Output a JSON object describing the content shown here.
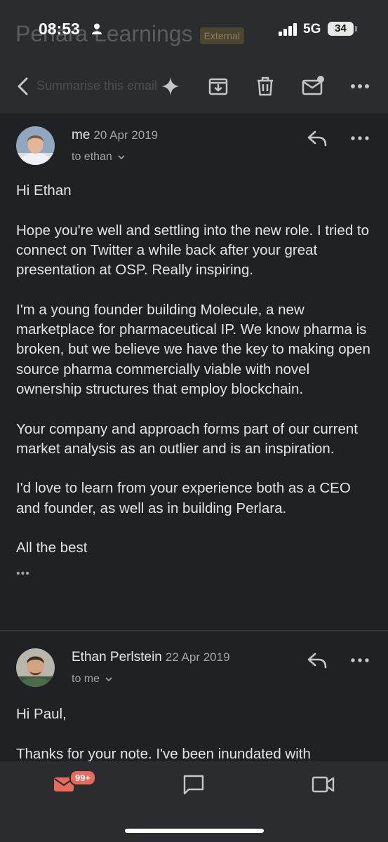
{
  "status_bar": {
    "time": "08:53",
    "network": "5G",
    "battery": "34"
  },
  "header": {
    "ghost_subject": "Perlara Learnings",
    "ghost_badge": "External",
    "ghost_summary": "Summarise this email"
  },
  "toolbar": {
    "icons": [
      "back-arrow-icon",
      "sparkle-icon",
      "archive-icon",
      "trash-icon",
      "mark-unread-icon",
      "more-icon"
    ]
  },
  "messages": [
    {
      "sender": "me",
      "date": "20 Apr 2019",
      "recipient": "to ethan",
      "paragraphs": [
        "Hi Ethan",
        "Hope you're well and settling into the new role. I tried to connect on Twitter a while back after your great presentation at OSP. Really inspiring.",
        "I'm a young founder building Molecule, a new marketplace for pharmaceutical IP. We know pharma is broken, but we believe we have the key to making open source pharma commercially viable with novel ownership structures that employ blockchain.",
        "Your company and approach forms part of our current market analysis as an outlier and is an inspiration.",
        "I'd love to learn from your experience both as a CEO and founder, as well as in building Perlara.",
        "All the best"
      ],
      "trimmed": "•••"
    },
    {
      "sender": "Ethan Perlstein",
      "date": "22 Apr 2019",
      "recipient": "to me",
      "paragraphs": [
        "Hi Paul,",
        "Thanks for your note. I've been inundated with"
      ]
    }
  ],
  "bottom_nav": {
    "mail_badge": "99+",
    "items": [
      "mail-icon",
      "chat-icon",
      "video-icon"
    ]
  },
  "colors": {
    "background": "#202124",
    "bar": "#2b2c2f",
    "badge": "#e86a5a"
  }
}
